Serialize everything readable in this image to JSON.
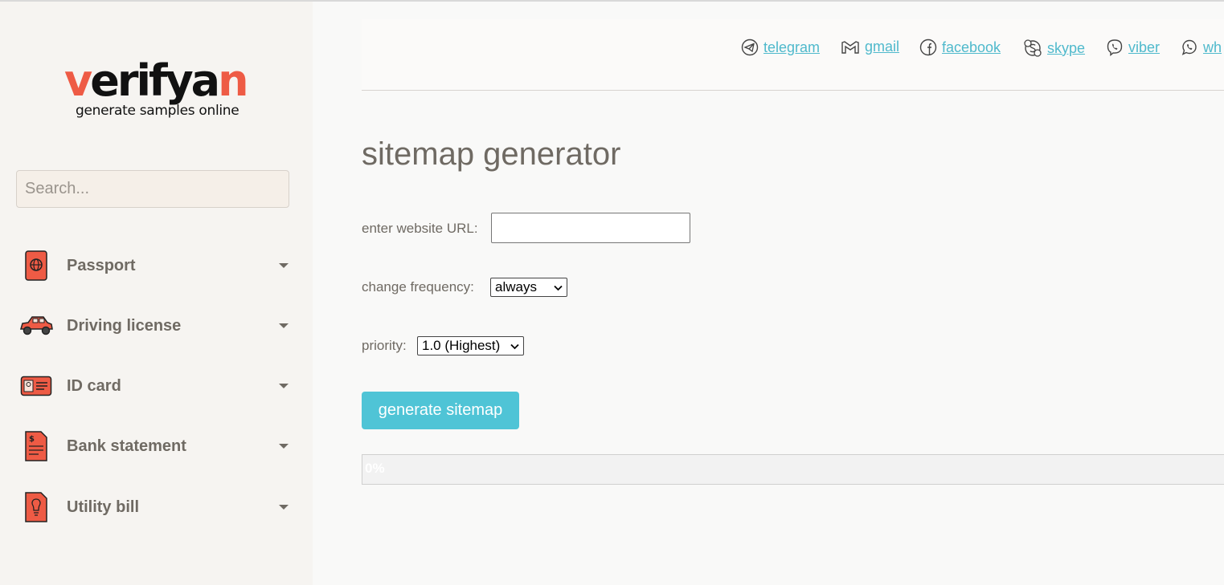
{
  "brand": {
    "logo_parts": [
      "v",
      "erifya",
      "n"
    ],
    "tagline": "generate samples online",
    "accent_color": "#ee5b45"
  },
  "search": {
    "placeholder": "Search..."
  },
  "sidebar": {
    "items": [
      {
        "label": "Passport",
        "icon": "passport-icon"
      },
      {
        "label": "Driving license",
        "icon": "car-icon"
      },
      {
        "label": "ID card",
        "icon": "id-card-icon"
      },
      {
        "label": "Bank statement",
        "icon": "bank-statement-icon"
      },
      {
        "label": "Utility bill",
        "icon": "utility-bill-icon"
      }
    ]
  },
  "header": {
    "links": [
      {
        "label": "telegram",
        "icon": "telegram-icon"
      },
      {
        "label": "gmail",
        "icon": "gmail-icon"
      },
      {
        "label": "facebook",
        "icon": "facebook-icon"
      },
      {
        "label": "skype",
        "icon": "skype-icon"
      },
      {
        "label": "viber",
        "icon": "viber-icon"
      },
      {
        "label": "wh",
        "icon": "whatsapp-icon"
      }
    ],
    "link_color": "#4fb9cc"
  },
  "main": {
    "title": "sitemap generator",
    "url_label": "enter website URL:",
    "url_value": "",
    "frequency_label": "change frequency:",
    "frequency_value": "always",
    "priority_label": "priority:",
    "priority_value": "1.0 (Highest)",
    "generate_label": "generate sitemap",
    "button_color": "#4fc4d6",
    "progress_percent": 0,
    "progress_text": "0%"
  }
}
